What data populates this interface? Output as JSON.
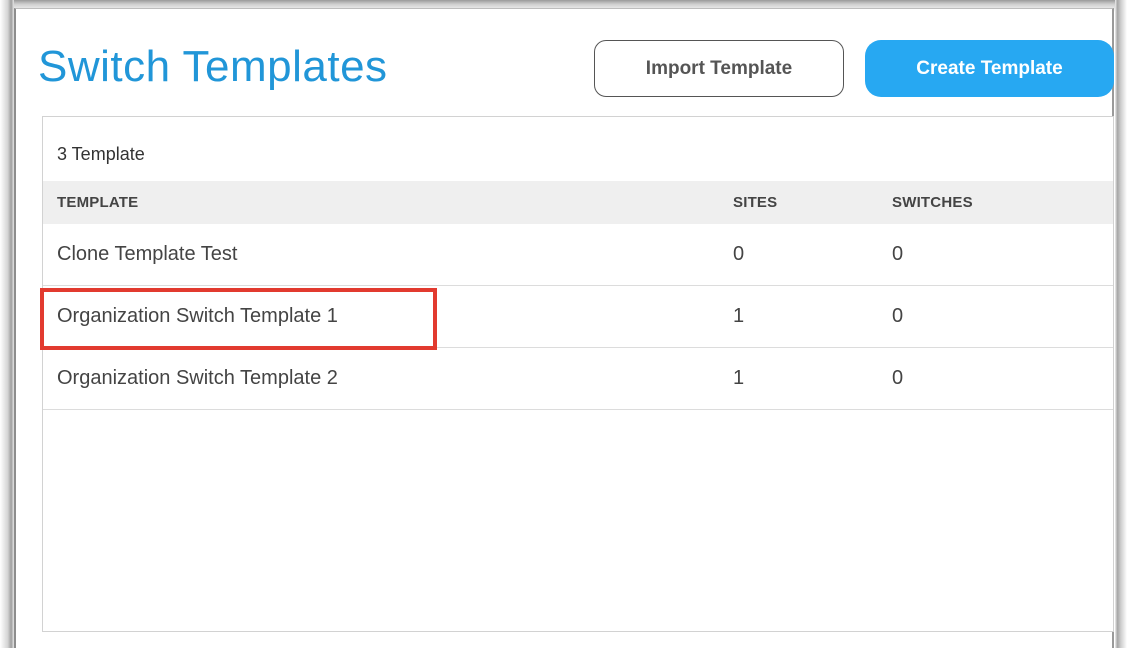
{
  "header": {
    "title": "Switch Templates",
    "import_label": "Import Template",
    "create_label": "Create Template"
  },
  "table": {
    "count_label": "3 Template",
    "columns": [
      "TEMPLATE",
      "SITES",
      "SWITCHES"
    ],
    "rows": [
      {
        "template": "Clone Template Test",
        "sites": "0",
        "switches": "0"
      },
      {
        "template": "Organization Switch Template 1",
        "sites": "1",
        "switches": "0",
        "highlighted": true
      },
      {
        "template": "Organization Switch Template 2",
        "sites": "1",
        "switches": "0"
      }
    ]
  },
  "colors": {
    "accent": "#2196d8",
    "primary_button": "#27a8f2",
    "highlight": "#e23a2f",
    "header_bg": "#efefef"
  }
}
